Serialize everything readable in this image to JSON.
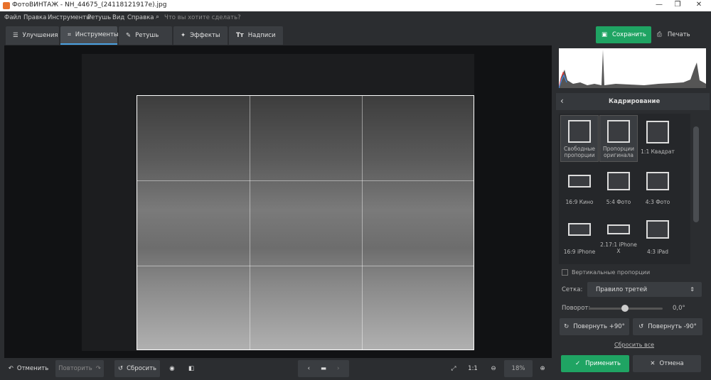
{
  "window": {
    "title": "ФотоВИНТАЖ - NH_44675_(24118121917e).jpg",
    "minimize": "—",
    "maximize": "❐",
    "close": "✕"
  },
  "menu": {
    "items": [
      "Файл",
      "Правка",
      "Инструменты",
      "Ретушь",
      "Вид",
      "Справка"
    ],
    "search_placeholder": "Что вы хотите сделать?"
  },
  "tabs": [
    {
      "label": "Улучшения"
    },
    {
      "label": "Инструменты"
    },
    {
      "label": "Ретушь"
    },
    {
      "label": "Эффекты"
    },
    {
      "label": "Надписи"
    }
  ],
  "actions": {
    "save": "Сохранить",
    "print": "Печать"
  },
  "bottom": {
    "undo": "Отменить",
    "redo": "Повторить",
    "reset": "Сбросить",
    "zoom_fit": "1:1",
    "zoom": "18%"
  },
  "crop": {
    "title": "Кадрирование",
    "presets": [
      {
        "label": "Свободные пропорции",
        "selected": true
      },
      {
        "label": "Пропорции оригинала",
        "selected": true
      },
      {
        "label": "1:1 Квадрат"
      },
      {
        "label": "16:9 Кино"
      },
      {
        "label": "5:4 Фото"
      },
      {
        "label": "4:3 Фото"
      },
      {
        "label": "16:9 iPhone"
      },
      {
        "label": "2.17:1 iPhone X"
      },
      {
        "label": "4:3 iPad"
      }
    ],
    "vertical": "Вертикальные пропорции",
    "grid_label": "Сетка:",
    "grid_value": "Правило третей",
    "rotation_label": "Поворот:",
    "rotation_value": "0,0°",
    "rotate_plus": "Повернуть +90°",
    "rotate_minus": "Повернуть -90°",
    "reset_all": "Сбросить все",
    "apply": "Применить",
    "cancel": "Отмена"
  },
  "colors": {
    "accent": "#1fa463",
    "tab_highlight": "#4aa0e0"
  }
}
